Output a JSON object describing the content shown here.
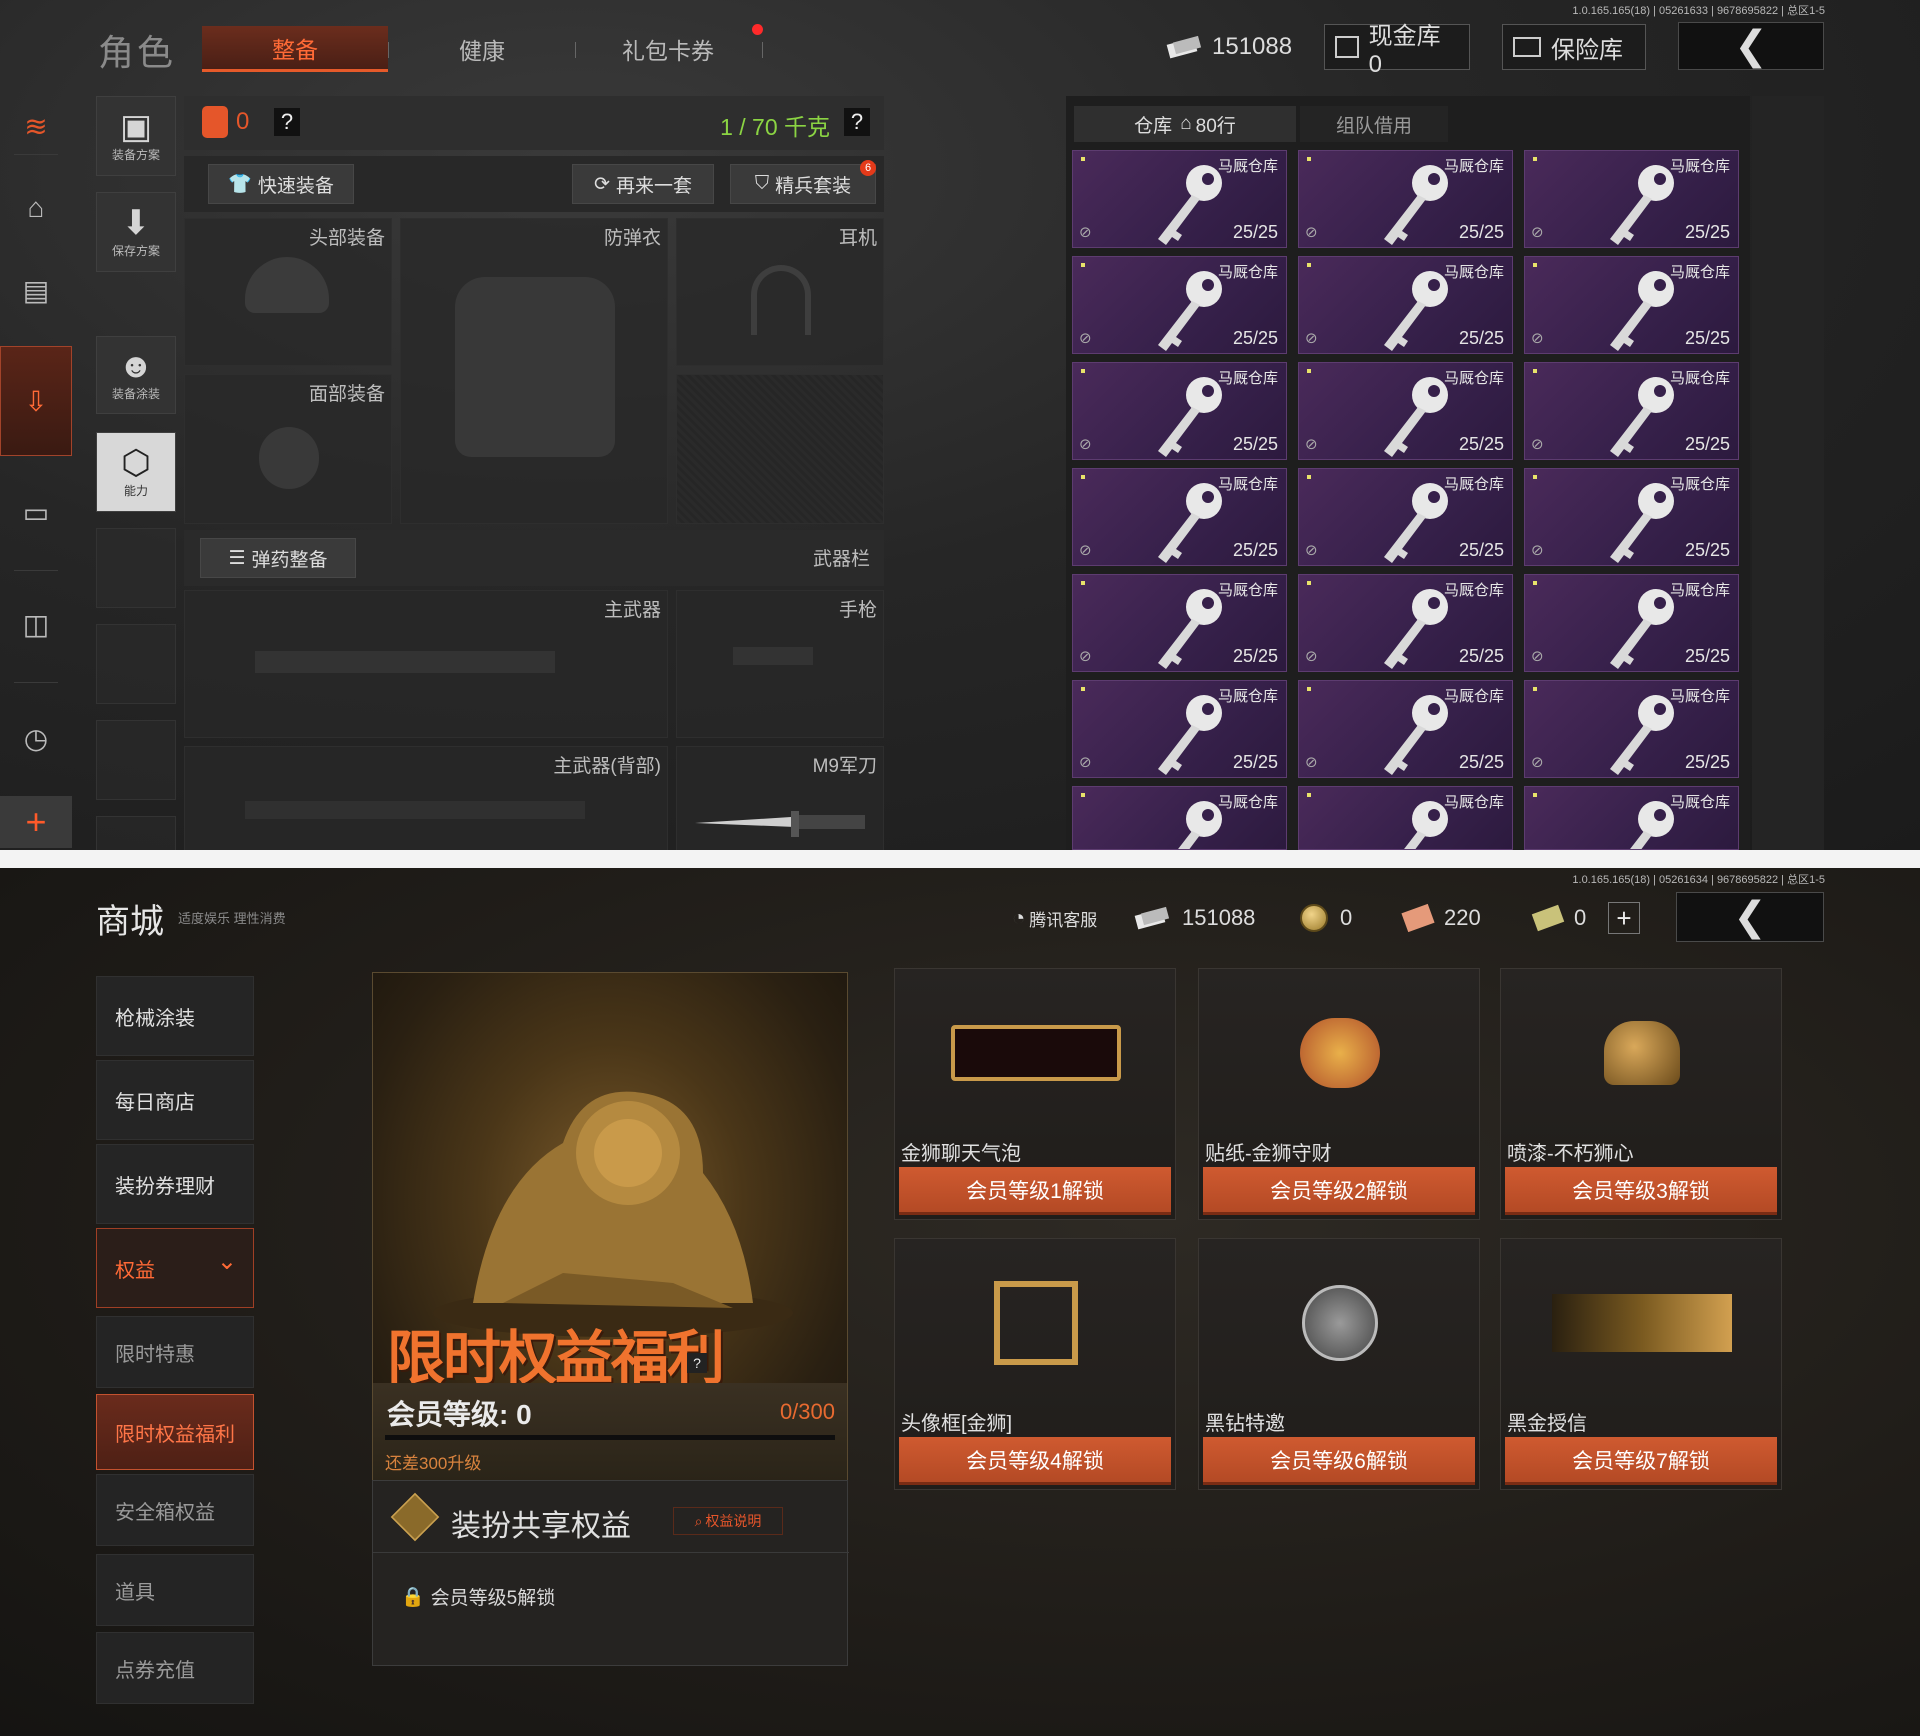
{
  "top": {
    "version": "1.0.165.165(18) | 05261633 | 9678695822 | 总区1-5",
    "title": "角色",
    "tabs": [
      {
        "label": "整备",
        "active": true
      },
      {
        "label": "健康",
        "active": false
      },
      {
        "label": "礼包卡券",
        "active": false
      }
    ],
    "currency": "151088",
    "cash_vault": "现金库 0",
    "safe_label": "保险库",
    "left_buttons": [
      {
        "label": "装备方案",
        "icon": "vest-icon"
      },
      {
        "label": "保存方案",
        "icon": "download-icon"
      },
      {
        "label": "装备涂装",
        "icon": "soldier-icon"
      },
      {
        "label": "能力",
        "icon": "ability-icon"
      }
    ],
    "loadout": {
      "count": "0",
      "help": "?",
      "weight": "1 / 70 千克",
      "quick_equip": "快速装备",
      "again": "再来一套",
      "elite": "精兵套装",
      "elite_badge": "6"
    },
    "slots": {
      "head": "头部装备",
      "vest": "防弹衣",
      "headset": "耳机",
      "face": "面部装备",
      "ammo_btn": "弹药整备",
      "weapon_bar": "武器栏",
      "primary": "主武器",
      "pistol": "手枪",
      "primary_back": "主武器(背部)",
      "knife": "M9军刀"
    },
    "storage": {
      "tab_warehouse": "仓库",
      "rows": "80行",
      "tab_team": "组队借用",
      "item_name": "马厩仓库",
      "item_count": "25/25"
    },
    "rside_plus": "+"
  },
  "bottom": {
    "version": "1.0.165.165(18) | 05261634 | 9678695822 | 总区1-5",
    "title": "商城",
    "subtitle": "适度娱乐 理性消费",
    "service": "腾讯客服",
    "currencies": [
      "151088",
      "0",
      "220",
      "0"
    ],
    "plus": "+",
    "menu": [
      {
        "label": "枪械涂装",
        "style": ""
      },
      {
        "label": "每日商店",
        "style": ""
      },
      {
        "label": "装扮券理财",
        "style": ""
      },
      {
        "label": "权益",
        "style": "sel"
      },
      {
        "label": "限时特惠",
        "style": "dim"
      },
      {
        "label": "限时权益福利",
        "style": "sel2"
      },
      {
        "label": "安全箱权益",
        "style": "dim"
      },
      {
        "label": "道具",
        "style": "dim"
      },
      {
        "label": "点券充值",
        "style": "dim"
      }
    ],
    "promo": {
      "title": "限时权益福利",
      "help": "?",
      "vip_label": "会员等级: 0",
      "progress_text": "0/300",
      "progress": 0,
      "upgrade_note": "还差300升级"
    },
    "share": {
      "title": "装扮共享权益",
      "explain": "权益说明",
      "lock_text": "会员等级5解锁"
    },
    "rewards": [
      {
        "name": "金狮聊天气泡",
        "button": "会员等级1解锁"
      },
      {
        "name": "贴纸-金狮守财",
        "button": "会员等级2解锁"
      },
      {
        "name": "喷漆-不朽狮心",
        "button": "会员等级3解锁"
      },
      {
        "name": "头像框[金狮]",
        "button": "会员等级4解锁"
      },
      {
        "name": "黑钻特邀",
        "button": "会员等级6解锁"
      },
      {
        "name": "黑金授信",
        "button": "会员等级7解锁"
      }
    ]
  }
}
